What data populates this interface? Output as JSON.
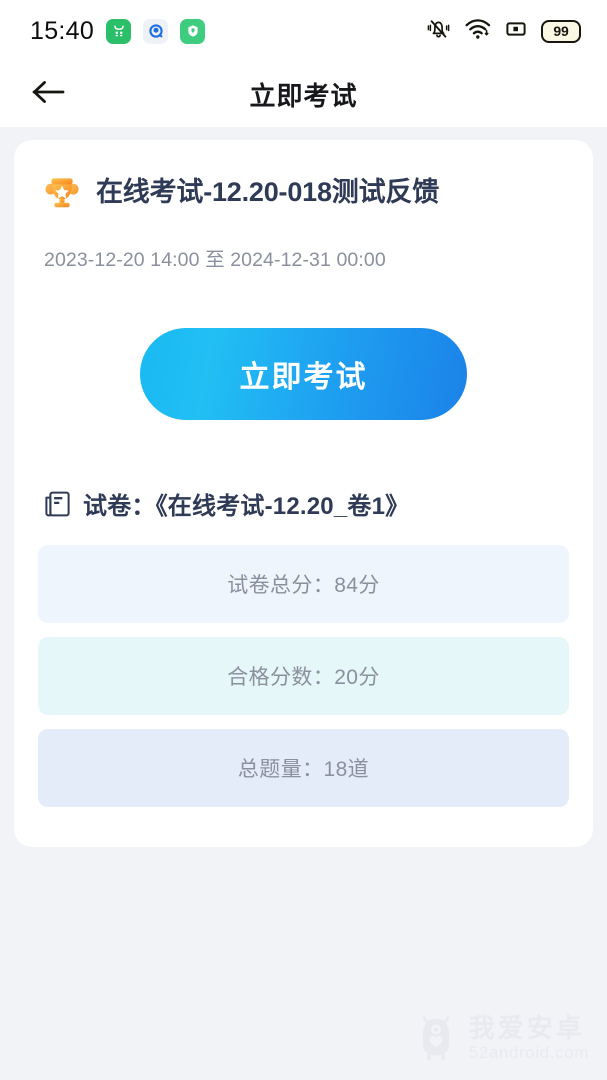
{
  "status_bar": {
    "time": "15:40",
    "app_icons": [
      {
        "name": "notification-app-icon-green",
        "glyph": "⑂"
      },
      {
        "name": "notification-app-icon-blue",
        "glyph": "◉"
      },
      {
        "name": "notification-app-icon-shield",
        "glyph": "▼"
      }
    ],
    "silent_icon": "bell-silent-icon",
    "wifi_icon": "wifi-icon",
    "signal_icon": "signal-icon",
    "battery_level": "99"
  },
  "nav": {
    "back_icon": "back-arrow-icon",
    "title": "立即考试"
  },
  "card": {
    "trophy_icon": "trophy-icon",
    "exam_title": "在线考试-12.20-018测试反馈",
    "date_range": "2023-12-20 14:00 至 2024-12-31 00:00",
    "cta_label": "立即考试",
    "paper_icon": "document-icon",
    "paper_text": "试卷：《在线考试-12.20_卷1》",
    "info_boxes": [
      {
        "label": "试卷总分：84分"
      },
      {
        "label": "合格分数：20分"
      },
      {
        "label": "总题量：18道"
      }
    ]
  },
  "watermark": {
    "cn": "我爱安卓",
    "en": "52android.com",
    "icon": "android-mascot-icon"
  },
  "colors": {
    "page_bg": "#f2f3f7",
    "card_bg": "#ffffff",
    "title_text": "#2f3a56",
    "muted_text": "#8b909e",
    "cta_gradient_start": "#19b9f2",
    "cta_gradient_end": "#1b82e8",
    "trophy_orange": "#f7a13a",
    "info_tint_1": "#eef5fc",
    "info_tint_2": "#e6f7f9",
    "info_tint_3": "#e4ecfa"
  }
}
